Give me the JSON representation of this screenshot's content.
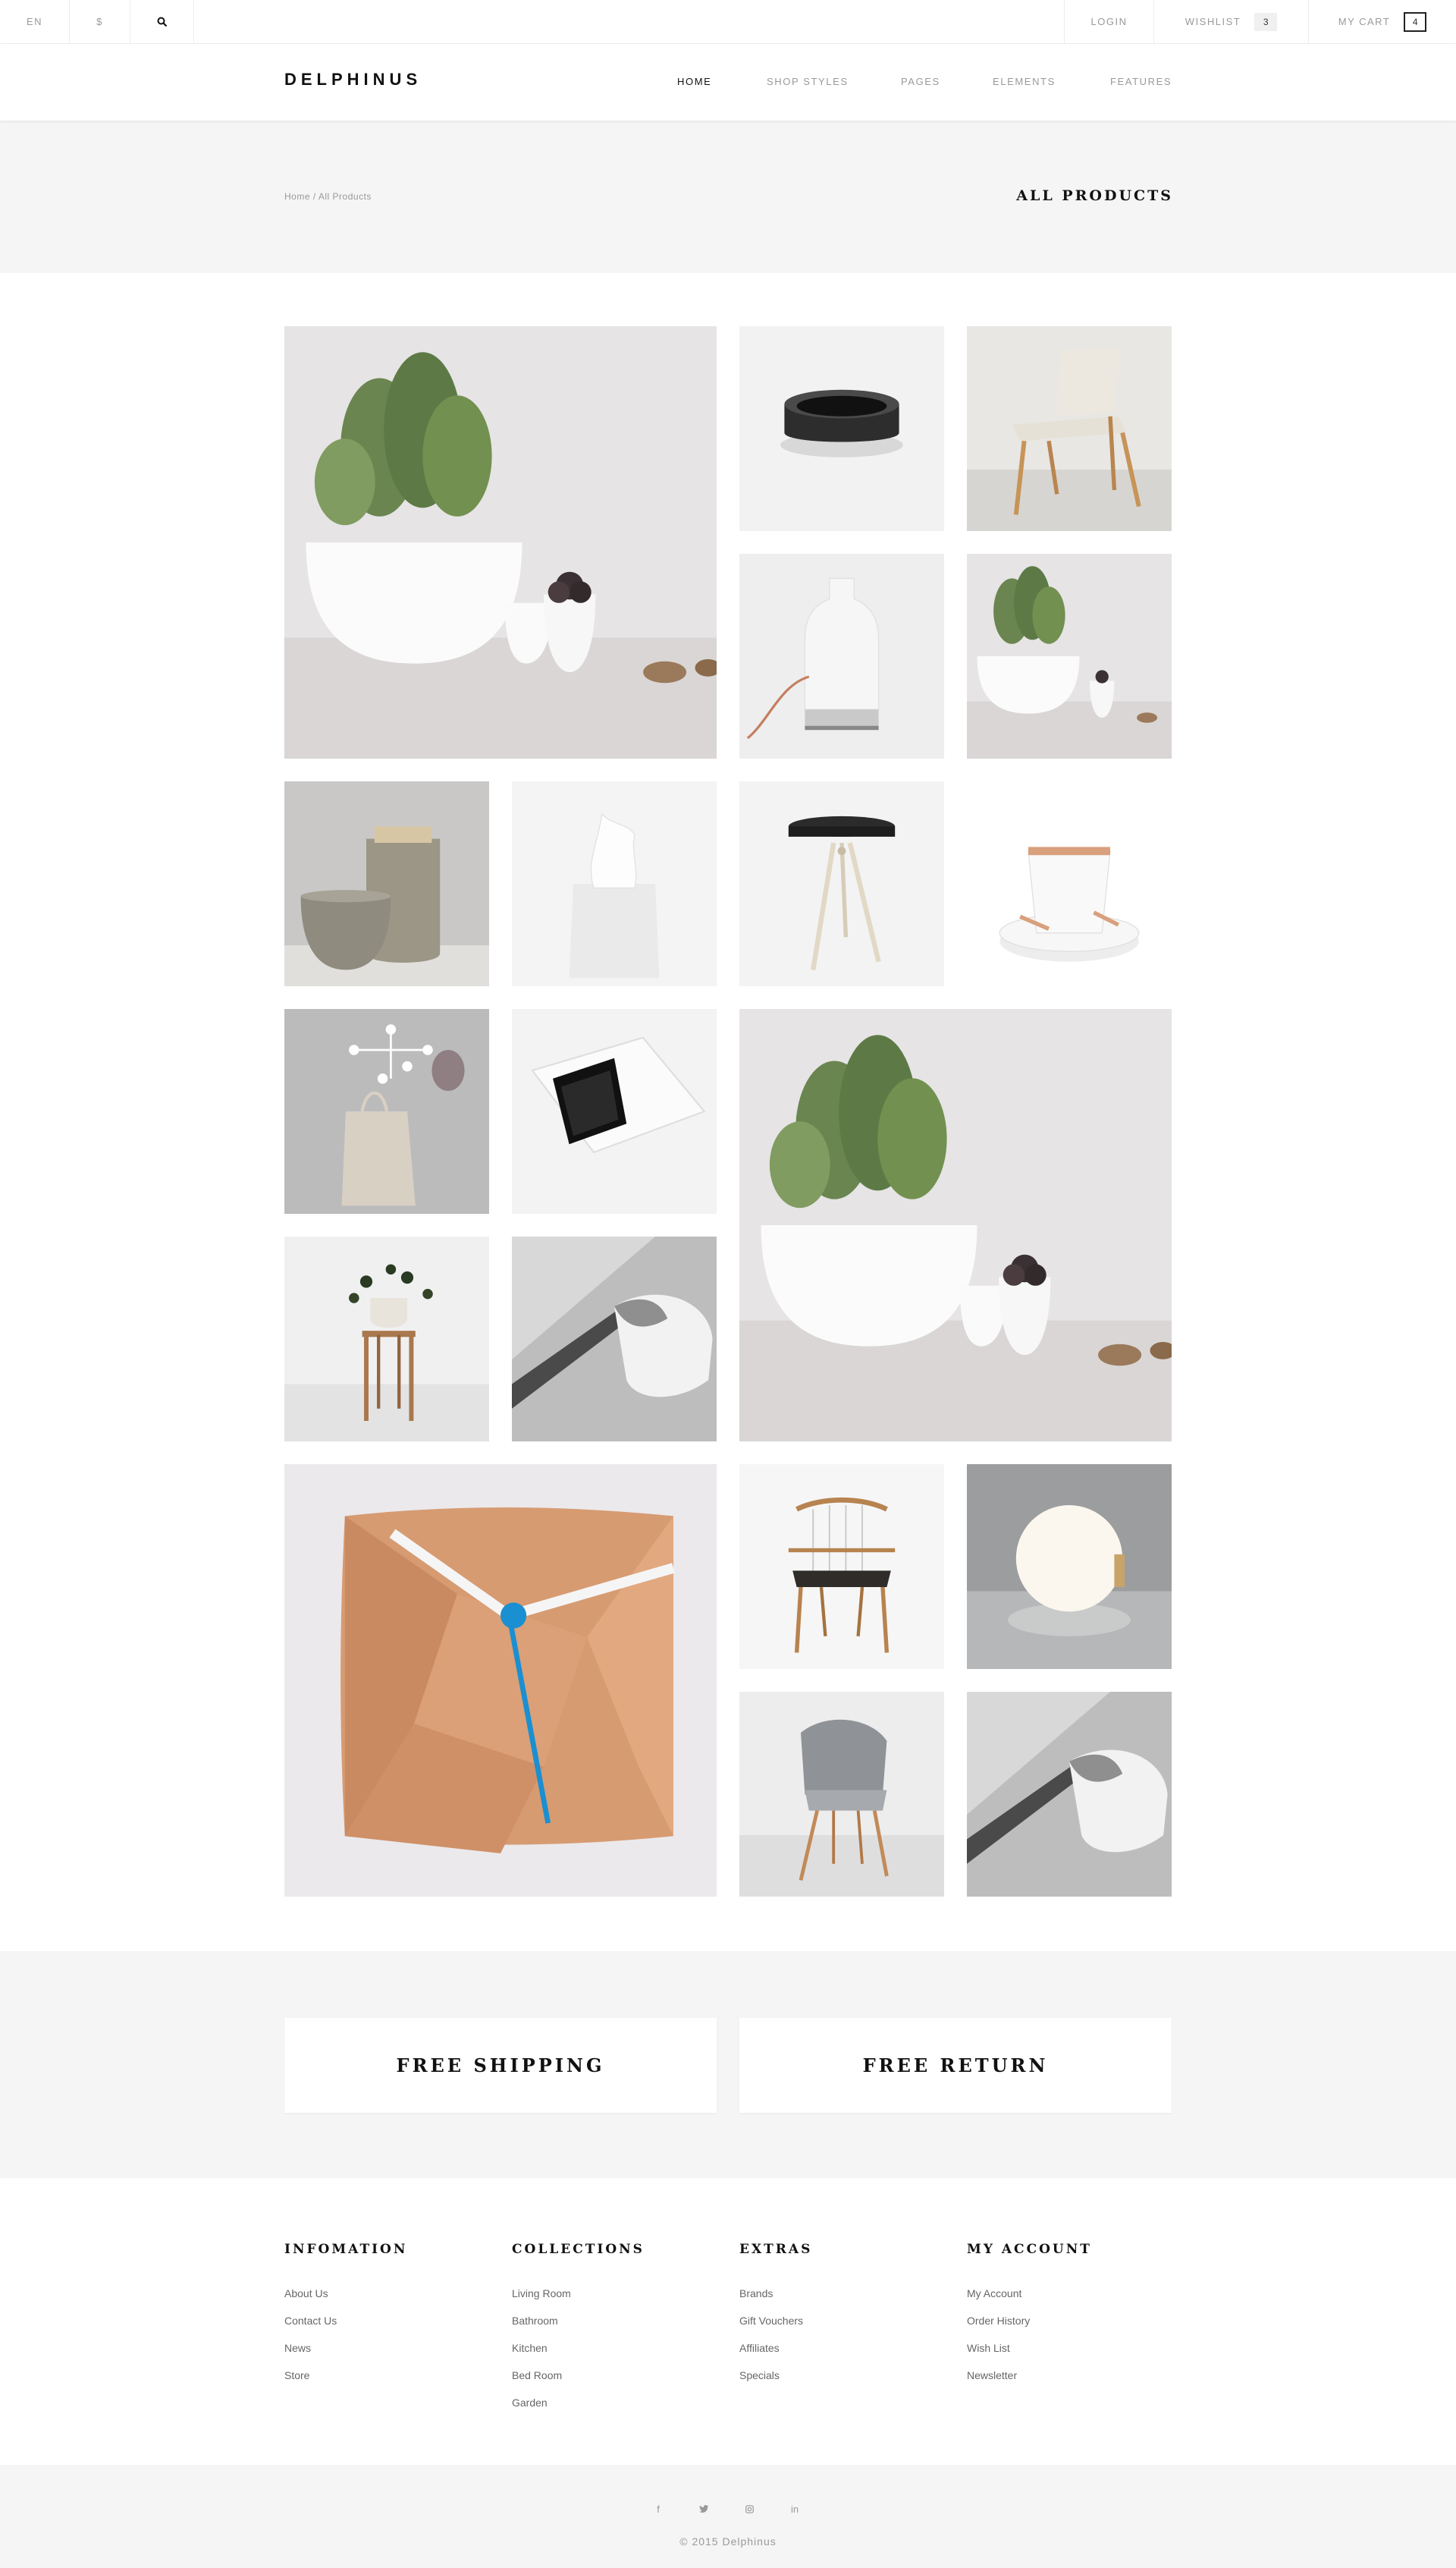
{
  "topbar": {
    "language": "EN",
    "currency": "$",
    "login": "LOGIN",
    "wishlist_label": "WISHLIST",
    "wishlist_count": "3",
    "cart_label": "MY CART",
    "cart_count": "4"
  },
  "header": {
    "logo": "DELPHINUS",
    "nav": [
      "HOME",
      "SHOP STYLES",
      "PAGES",
      "ELEMENTS",
      "FEATURES"
    ],
    "active_nav": "HOME"
  },
  "banner": {
    "breadcrumb_home": "Home",
    "breadcrumb_sep": "/",
    "breadcrumb_current": "All Products",
    "title": "ALL PRODUCTS"
  },
  "products": [
    {
      "name": "bok-choy-planter-large",
      "icon": "plant-pot-image"
    },
    {
      "name": "black-stone-bowl",
      "icon": "bowl-image"
    },
    {
      "name": "wooden-chair",
      "icon": "chair-image"
    },
    {
      "name": "white-bottle-lamp",
      "icon": "lamp-image"
    },
    {
      "name": "bok-choy-planter",
      "icon": "plant-pot-image"
    },
    {
      "name": "ceramic-vases",
      "icon": "vase-image"
    },
    {
      "name": "tissue-box",
      "icon": "tissue-box-image"
    },
    {
      "name": "black-stool",
      "icon": "stool-image"
    },
    {
      "name": "bucket-with-tray",
      "icon": "bucket-image"
    },
    {
      "name": "wall-hooks-bag",
      "icon": "hook-image"
    },
    {
      "name": "phone-dock",
      "icon": "dock-image"
    },
    {
      "name": "bok-choy-planter-large-2",
      "icon": "plant-pot-image"
    },
    {
      "name": "plant-stand",
      "icon": "plant-stand-image"
    },
    {
      "name": "laptop-cup",
      "icon": "cup-image"
    },
    {
      "name": "wooden-wall-clock",
      "icon": "clock-image"
    },
    {
      "name": "string-armchair",
      "icon": "armchair-image"
    },
    {
      "name": "globe-lamp",
      "icon": "globe-lamp-image"
    },
    {
      "name": "grey-shell-chair",
      "icon": "shell-chair-image"
    },
    {
      "name": "laptop-cup-2",
      "icon": "cup-image"
    }
  ],
  "services": [
    "FREE SHIPPING",
    "FREE RETURN"
  ],
  "footer": {
    "columns": [
      {
        "title": "INFOMATION",
        "links": [
          "About Us",
          "Contact Us",
          "News",
          "Store"
        ]
      },
      {
        "title": "COLLECTIONS",
        "links": [
          "Living Room",
          "Bathroom",
          "Kitchen",
          "Bed Room",
          "Garden"
        ]
      },
      {
        "title": "EXTRAS",
        "links": [
          "Brands",
          "Gift Vouchers",
          "Affiliates",
          "Specials"
        ]
      },
      {
        "title": "MY ACCOUNT",
        "links": [
          "My Account",
          "Order History",
          "Wish List",
          "Newsletter"
        ]
      }
    ],
    "social": [
      "f",
      "t",
      "ig",
      "in"
    ],
    "copyright": "© 2015 Delphinus"
  },
  "colors": {
    "accent": "#111111",
    "muted": "#999999",
    "panel": "#f5f5f5",
    "clock_hand": "#1a8fd1"
  }
}
